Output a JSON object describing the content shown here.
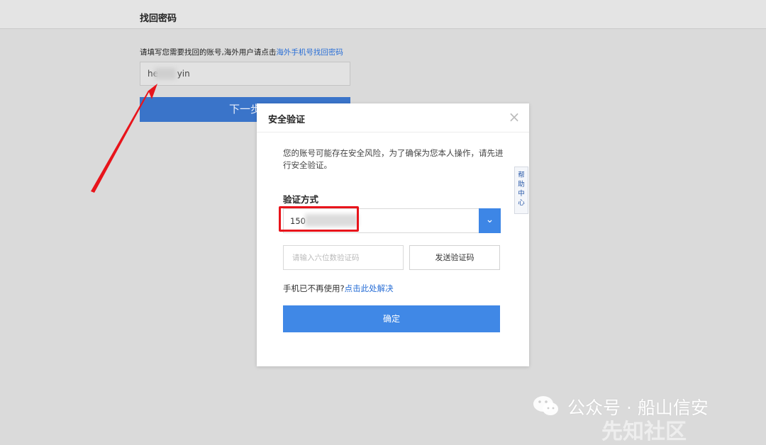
{
  "header": {
    "title": "找回密码"
  },
  "recover_form": {
    "hint_text": "请填写您需要找回的账号,海外用户请点击",
    "overseas_link": "海外手机号找回密码",
    "account_value": "he       yin",
    "next_button": "下一步"
  },
  "modal": {
    "title": "安全验证",
    "close_glyph": "×",
    "description": "您的账号可能存在安全风险，为了确保为您本人操作，请先进行安全验证。",
    "method_label": "验证方式",
    "method_value": "150",
    "dropdown_glyph": "⌄",
    "code_placeholder": "请输入六位数验证码",
    "send_code_button": "发送验证码",
    "phone_unavailable_text": "手机已不再使用?",
    "phone_unavailable_link": "点击此处解决",
    "confirm_button": "确定"
  },
  "help_center": {
    "label": "帮助中心"
  },
  "watermark": {
    "text": "公众号 · 船山信安",
    "faint_text": "先知社区"
  },
  "colors": {
    "primary": "#4088e6",
    "link": "#2a6fd6",
    "highlight": "#e8141b",
    "overlay": "#dadada"
  }
}
